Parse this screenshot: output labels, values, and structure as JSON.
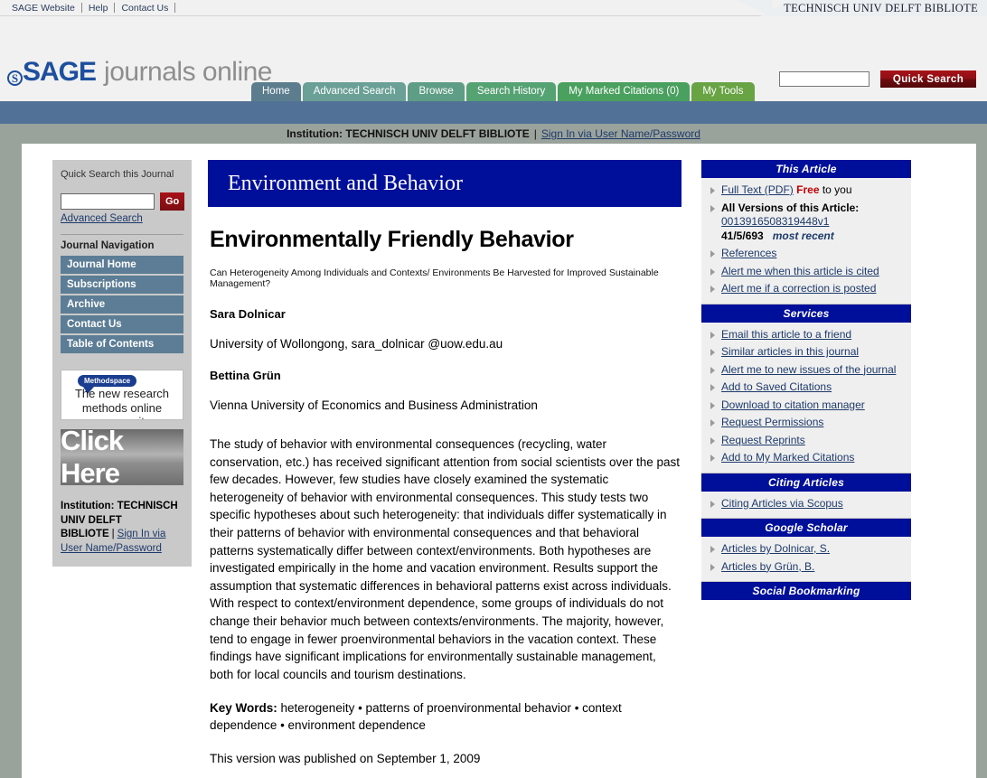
{
  "topbar": {
    "links": [
      "SAGE Website",
      "Help",
      "Contact Us"
    ],
    "institution": "TECHNISCH UNIV DELFT BIBLIOTE"
  },
  "masthead": {
    "logo_mark": "S",
    "logo_brand": "SAGE",
    "logo_rest": "journals online",
    "search": {
      "value": "",
      "placeholder": "",
      "button": "Quick Search"
    },
    "tabs": [
      "Home",
      "Advanced Search",
      "Browse",
      "Search History",
      "My Marked Citations (0)",
      "My Tools"
    ]
  },
  "institution_bar": {
    "label": "Institution: TECHNISCH UNIV DELFT BIBLIOTE",
    "separator": "|",
    "signin": "Sign In via User Name/Password"
  },
  "sidebar_left": {
    "quick_search_title": "Quick Search this Journal",
    "search_value": "",
    "go_label": "Go",
    "advanced_search": "Advanced Search",
    "nav_title": "Journal Navigation",
    "nav_items": [
      "Journal Home",
      "Subscriptions",
      "Archive",
      "Contact Us",
      "Table of Contents"
    ],
    "ad": {
      "badge": "Methodspace",
      "line1": "The new research",
      "line2": "methods online community",
      "click_here": "Click Here"
    },
    "institution": {
      "label": "Institution: TECHNISCH UNIV DELFT BIBLIOTE",
      "separator": "|",
      "signin": "Sign In via User Name/Password"
    }
  },
  "article": {
    "journal": "Environment and Behavior",
    "title": "Environmentally Friendly Behavior",
    "subtitle": "Can Heterogeneity Among Individuals and Contexts/ Environments Be Harvested for Improved Sustainable Management?",
    "author1": "Sara Dolnicar",
    "affiliation1": "University of Wollongong, sara_dolnicar @uow.edu.au",
    "author2": "Bettina Grün",
    "affiliation2": "Vienna University of Economics and Business Administration",
    "abstract": "The study of behavior with environmental consequences (recycling, water conservation, etc.) has received significant attention from social scientists over the past few decades. However, few studies have closely examined the systematic heterogeneity of behavior with environmental consequences. This study tests two specific hypotheses about such heterogeneity: that individuals differ systematically in their patterns of behavior with environmental consequences and that behavioral patterns systematically differ between context/environments. Both hypotheses are investigated empirically in the home and vacation environment. Results support the assumption that systematic differences in behavioral patterns exist across individuals. With respect to context/environment dependence, some groups of individuals do not change their behavior much between contexts/environments. The majority, however, tend to engage in fewer proenvironmental behaviors in the vacation context. These findings have significant implications for environmentally sustainable management, both for local councils and tourism destinations.",
    "keywords_label": "Key Words:",
    "keywords": " heterogeneity • patterns of proenvironmental behavior • context dependence • environment dependence",
    "published": "This version was published on September 1, 2009"
  },
  "sidebar_right": {
    "this_article": {
      "heading": "This Article",
      "full_text": "Full Text (PDF)",
      "free": "Free",
      "free_suffix": " to you",
      "all_versions_label": "All Versions of this Article:",
      "version_id": "0013916508319448v1",
      "version_locator": "41/5/693",
      "version_note": "most recent",
      "references": "References",
      "alert_cited": "Alert me when this article is cited",
      "alert_correction": "Alert me if a correction is posted"
    },
    "services": {
      "heading": "Services",
      "items": [
        "Email this article to a friend",
        "Similar articles in this journal",
        "Alert me to new issues of the journal",
        "Add to Saved Citations",
        "Download to citation manager",
        "Request Permissions",
        "Request Reprints",
        "Add to My Marked Citations"
      ]
    },
    "citing_articles": {
      "heading": "Citing Articles",
      "items": [
        "Citing Articles via Scopus"
      ]
    },
    "google_scholar": {
      "heading": "Google Scholar",
      "items": [
        "Articles by Dolnicar, S.",
        "Articles by Grün, B."
      ]
    },
    "social_bookmarking": {
      "heading": "Social Bookmarking"
    }
  }
}
